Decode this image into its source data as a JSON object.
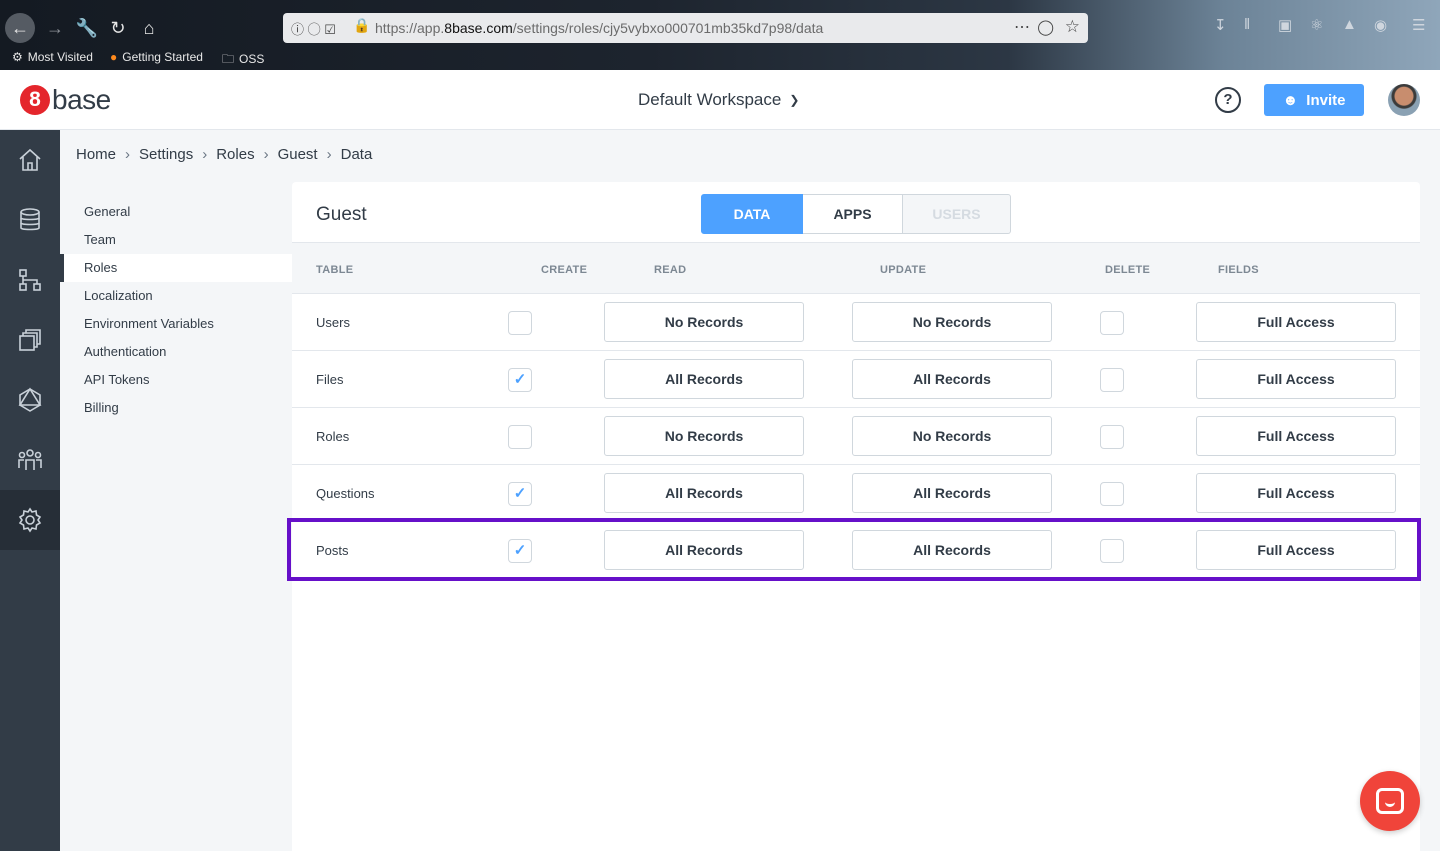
{
  "browser": {
    "url_prefix": "https://app.",
    "url_domain": "8base.com",
    "url_path": "/settings/roles/cjy5vybxo000701mb35kd7p98/data",
    "bookmarks": [
      {
        "label": "Most Visited",
        "icon": "gear-icon"
      },
      {
        "label": "Getting Started",
        "icon": "firefox-icon"
      },
      {
        "label": "OSS",
        "icon": "folder-icon"
      }
    ]
  },
  "header": {
    "logo_mark": "8",
    "logo_text": "base",
    "workspace": "Default Workspace",
    "help": "?",
    "invite_label": "Invite"
  },
  "breadcrumb": [
    "Home",
    "Settings",
    "Roles",
    "Guest",
    "Data"
  ],
  "settings_menu": [
    "General",
    "Team",
    "Roles",
    "Localization",
    "Environment Variables",
    "Authentication",
    "API Tokens",
    "Billing"
  ],
  "active_menu": "Roles",
  "role": {
    "title": "Guest",
    "tabs": [
      "DATA",
      "APPS",
      "USERS"
    ],
    "active_tab": "DATA"
  },
  "table": {
    "headers": [
      "TABLE",
      "CREATE",
      "READ",
      "UPDATE",
      "DELETE",
      "FIELDS"
    ],
    "rows": [
      {
        "name": "Users",
        "create": false,
        "read": "No Records",
        "update": "No Records",
        "delete": false,
        "fields": "Full Access"
      },
      {
        "name": "Files",
        "create": true,
        "read": "All Records",
        "update": "All Records",
        "delete": false,
        "fields": "Full Access"
      },
      {
        "name": "Roles",
        "create": false,
        "read": "No Records",
        "update": "No Records",
        "delete": false,
        "fields": "Full Access"
      },
      {
        "name": "Questions",
        "create": true,
        "read": "All Records",
        "update": "All Records",
        "delete": false,
        "fields": "Full Access"
      },
      {
        "name": "Posts",
        "create": true,
        "read": "All Records",
        "update": "All Records",
        "delete": false,
        "fields": "Full Access"
      }
    ]
  },
  "highlighted_row": "Posts",
  "colors": {
    "accent": "#4da1ff",
    "sidebar": "#323c47",
    "highlight": "#6610c9",
    "brand_red": "#e4262c",
    "chat": "#f0443a"
  }
}
